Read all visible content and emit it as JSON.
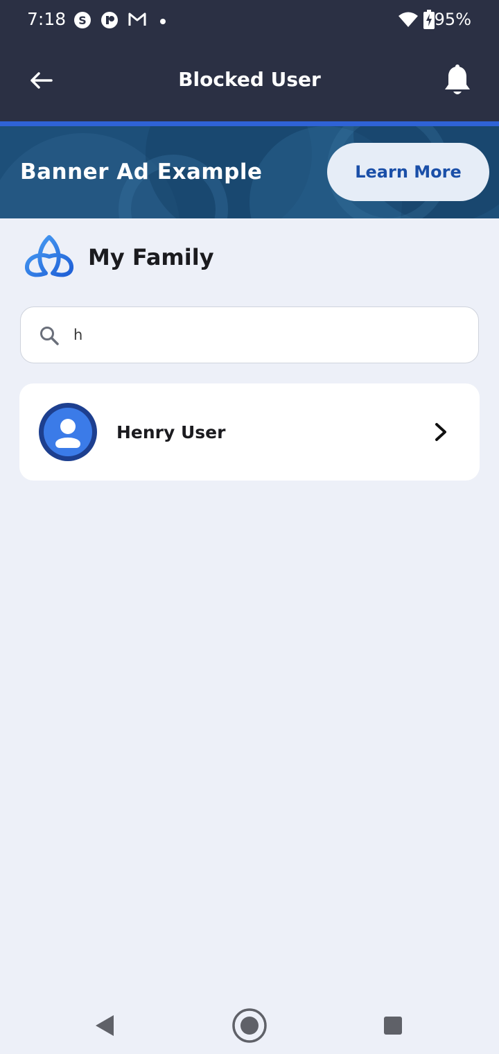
{
  "status_bar": {
    "time": "7:18",
    "battery": "95%",
    "notification_icons": [
      "skype-icon",
      "reddit-like-icon",
      "gmail-icon",
      "dot-icon"
    ],
    "system_icons": [
      "wifi-icon",
      "battery-charging-icon"
    ]
  },
  "app_bar": {
    "title": "Blocked User",
    "back_icon": "arrow-left-icon",
    "action_icon": "bell-icon"
  },
  "banner": {
    "title": "Banner Ad Example",
    "button_label": "Learn More"
  },
  "section": {
    "title": "My Family",
    "logo_icon": "triquetra-logo-icon"
  },
  "search": {
    "value": "h",
    "icon": "search-icon"
  },
  "users": [
    {
      "name": "Henry User",
      "avatar_icon": "person-icon",
      "chevron_icon": "chevron-right-icon"
    }
  ],
  "colors": {
    "app_bar": "#2b3044",
    "accent_line": "#2f63d6",
    "banner_bg": "#1c4f7a",
    "button_text": "#1a4fa8",
    "page_bg": "#edf0f8",
    "avatar_ring": "#1d3f8f",
    "avatar_fill": "#3b7be8"
  }
}
